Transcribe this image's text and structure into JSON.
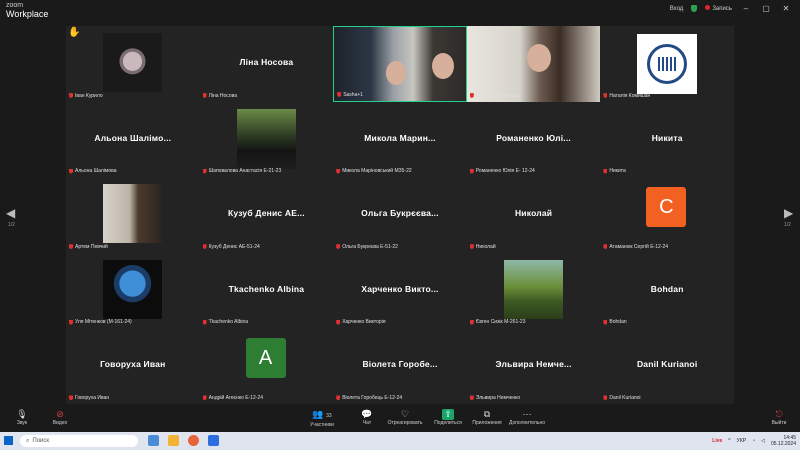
{
  "app": {
    "logo_top": "zoom",
    "logo_bottom": "Workplace"
  },
  "titlebar": {
    "sign_in": "Вход",
    "recording": "Запись",
    "icons": [
      "shield-icon",
      "record-icon",
      "minimize-icon",
      "maximize-icon",
      "close-icon"
    ]
  },
  "pagination": {
    "left": "1/2",
    "right": "1/2"
  },
  "tiles": [
    {
      "kind": "photo",
      "photo": "ph1",
      "label": "Іван Курило"
    },
    {
      "kind": "name",
      "name": "Ліна Носова",
      "label": "Ліна Носова"
    },
    {
      "kind": "video",
      "video": "vid1",
      "label": "Sasha+1",
      "active": true
    },
    {
      "kind": "video",
      "video": "vid2",
      "label": "Наталя Гаврієнова"
    },
    {
      "kind": "logo",
      "label": "Наталія Комишан"
    },
    {
      "kind": "name",
      "name": "Альона Шалімо...",
      "label": "Альона Шалімова"
    },
    {
      "kind": "photo",
      "photo": "ph-blonde",
      "label": "Шаповалова Анастасія Е-21-23"
    },
    {
      "kind": "name",
      "name": "Микола Марин...",
      "label": "Микола Маріновський МЗ5-22"
    },
    {
      "kind": "name",
      "name": "Романенко Юлі...",
      "label": "Романенко Юлія Е- 12-24"
    },
    {
      "kind": "name",
      "name": "Никита",
      "label": "Никита"
    },
    {
      "kind": "photo",
      "photo": "ph-man",
      "label": "Артем Певчий"
    },
    {
      "kind": "name",
      "name": "Кузуб Денис АЕ...",
      "label": "Кузуб Денис АЕ-51-24"
    },
    {
      "kind": "name",
      "name": "Ольга Букрєєва...",
      "label": "Ольга Букреєва Е-51-22"
    },
    {
      "kind": "name",
      "name": "Николай",
      "label": "Николай"
    },
    {
      "kind": "avatar",
      "letter": "C",
      "color": "#f26122",
      "label": "Атаманюк Сергій Е-12-24"
    },
    {
      "kind": "photo",
      "photo": "ph-smurf",
      "label": "Уля Мітенков (М-161-24)"
    },
    {
      "kind": "name",
      "name": "Tkachenko Albina",
      "label": "Tkachenko Albina"
    },
    {
      "kind": "name",
      "name": "Харченко Викто...",
      "label": "Харченко Викторія"
    },
    {
      "kind": "photo",
      "photo": "ph-bike",
      "label": "Євген Сизік М-261-23"
    },
    {
      "kind": "name",
      "name": "Bohdan",
      "label": "Bohdan"
    },
    {
      "kind": "name",
      "name": "Говоруха Иван",
      "label": "Говоруха Иван"
    },
    {
      "kind": "avatar",
      "letter": "A",
      "color": "#2d7d32",
      "label": "Андрій Агеєнко Е-12-24"
    },
    {
      "kind": "name",
      "name": "Віолета Горобе...",
      "label": "Віолета Горобець Е-12-24"
    },
    {
      "kind": "name",
      "name": "Эльвира Немче...",
      "label": "Эльвира Немченко"
    },
    {
      "kind": "name",
      "name": "Danil Kurianoi",
      "label": "Danil Kurianoi"
    }
  ],
  "toolbar": {
    "audio": "Звук",
    "video": "Видео",
    "participants": "Участники",
    "participants_count": "33",
    "chat": "Чат",
    "react": "Отреагировать",
    "share": "Поделиться",
    "apps": "Приложения",
    "more": "Дополнительно",
    "leave": "Выйти"
  },
  "taskbar": {
    "search_placeholder": "Поиск",
    "live": "Live",
    "lang": "УКР",
    "time": "14:45",
    "date": "05.12.2024"
  },
  "colors": {
    "active_border": "#23d18b",
    "share_green": "#1aa36b",
    "muted_red": "#e03030"
  }
}
